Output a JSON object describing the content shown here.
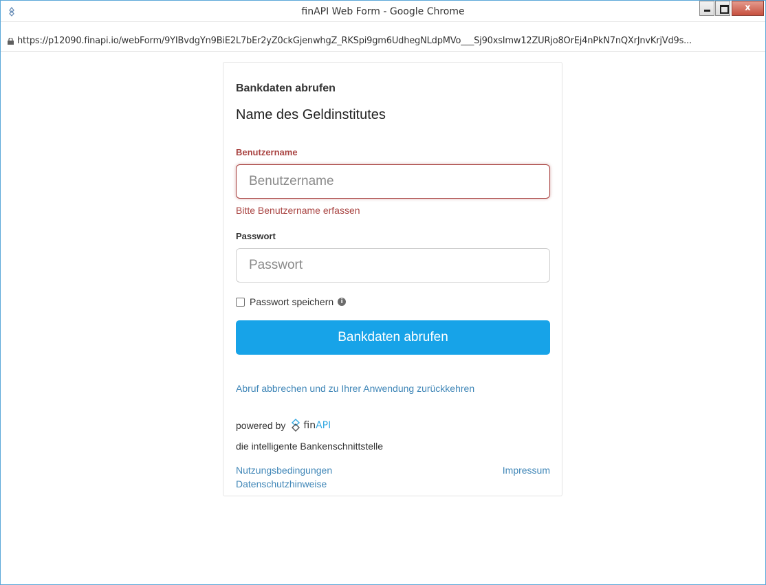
{
  "window": {
    "title": "finAPI Web Form - Google Chrome",
    "close_label": "x"
  },
  "addressbar": {
    "url": "https://p12090.finapi.io/webForm/9YIBvdgYn9BiE2L7bEr2yZ0ckGjenwhgZ_RKSpi9gm6UdhegNLdpMVo___Sj90xsImw12ZURjo8OrEj4nPkN7nQXrJnvKrjVd9s..."
  },
  "form": {
    "title": "Bankdaten abrufen",
    "bank_name": "Name des Geldinstitutes",
    "username": {
      "label": "Benutzername",
      "placeholder": "Benutzername",
      "value": "",
      "error": "Bitte Benutzername erfassen"
    },
    "password": {
      "label": "Passwort",
      "placeholder": "Passwort",
      "value": ""
    },
    "remember": {
      "label": "Passwort speichern",
      "checked": false,
      "info_glyph": "i"
    },
    "submit_label": "Bankdaten abrufen",
    "cancel_link": "Abruf abbrechen und zu Ihrer Anwendung zurückkehren"
  },
  "footer": {
    "powered_by": "powered by",
    "logo_fin": "fin",
    "logo_api": "API",
    "tagline": "die intelligente Bankenschnittstelle",
    "terms": "Nutzungsbedingungen",
    "privacy": "Datenschutzhinweise",
    "imprint": "Impressum"
  },
  "colors": {
    "accent_button": "#17a3e8",
    "error": "#a94442",
    "link": "#3f86b7",
    "window_border": "#5aa7d8"
  },
  "icons": [
    "app-icon",
    "lock-icon",
    "minimize-icon",
    "maximize-icon",
    "close-icon",
    "info-icon",
    "finapi-logo-icon"
  ]
}
